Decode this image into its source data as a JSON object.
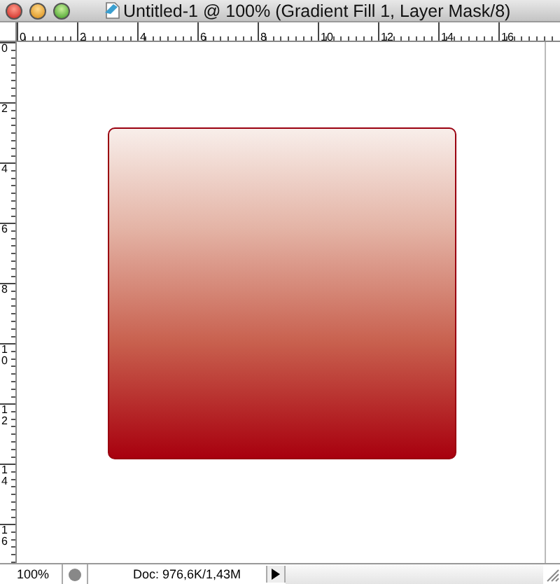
{
  "window": {
    "title": "Untitled-1 @ 100% (Gradient Fill 1, Layer Mask/8)"
  },
  "rulers": {
    "horizontal": [
      "0",
      "2",
      "4",
      "6",
      "8",
      "10",
      "12",
      "14",
      "16"
    ],
    "vertical": [
      "0",
      "2",
      "4",
      "6",
      "8",
      "10",
      "12",
      "14",
      "16"
    ]
  },
  "status_bar": {
    "zoom": "100%",
    "doc_info": "Doc: 976,6K/1,43M"
  }
}
